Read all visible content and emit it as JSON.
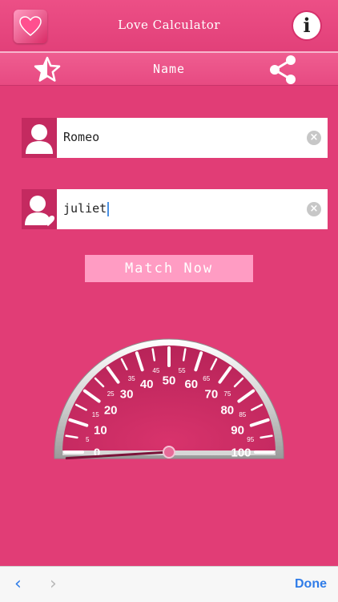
{
  "header": {
    "title": "Love Calculator",
    "info_icon": "i"
  },
  "toolbar": {
    "subtitle": "Name",
    "favorite_icon": "star-icon",
    "share_icon": "share-icon"
  },
  "form": {
    "name1": {
      "value": "Romeo",
      "icon": "person-icon"
    },
    "name2": {
      "value": "juliet",
      "icon": "person-heart-icon"
    },
    "clear_glyph": "×",
    "match_label": "Match Now"
  },
  "gauge": {
    "major_labels": [
      "0",
      "10",
      "20",
      "30",
      "40",
      "50",
      "60",
      "70",
      "80",
      "90",
      "100"
    ],
    "minor_labels": [
      "5",
      "15",
      "25",
      "35",
      "45",
      "55",
      "65",
      "75",
      "85",
      "95"
    ],
    "needle_value": 0
  },
  "bottombar": {
    "back_glyph": "‹",
    "forward_glyph": "›",
    "done_label": "Done"
  },
  "colors": {
    "background": "#e13d76",
    "button": "#ff9cc3",
    "gauge_face": "#c42a60",
    "link": "#2f7ce8"
  }
}
